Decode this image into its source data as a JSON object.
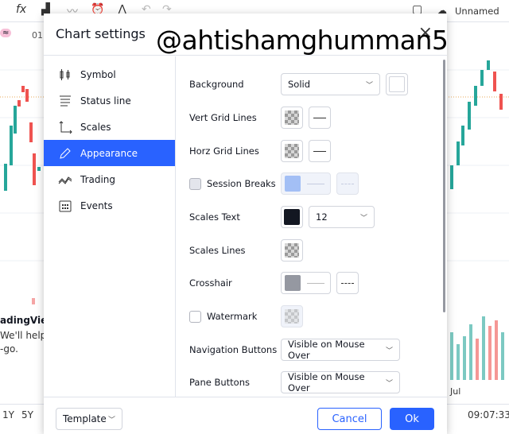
{
  "topbar": {
    "fx_icon": "fx",
    "profile_label": "Unnamed"
  },
  "background": {
    "symbol_partial": "01",
    "promo_title": "adingView",
    "promo_line1": "We'll help y",
    "promo_line2": "-go.",
    "axis_label": "Jul",
    "ranges": [
      "1Y",
      "5Y"
    ],
    "clock": "09:07:33"
  },
  "dialog": {
    "title": "Chart settings",
    "watermark_text": "@ahtishamghumman5",
    "close_icon": "×",
    "nav": [
      {
        "label": "Symbol",
        "icon": "candles-icon"
      },
      {
        "label": "Status line",
        "icon": "status-line-icon"
      },
      {
        "label": "Scales",
        "icon": "scales-icon"
      },
      {
        "label": "Appearance",
        "icon": "pencil-icon",
        "active": true
      },
      {
        "label": "Trading",
        "icon": "trading-icon"
      },
      {
        "label": "Events",
        "icon": "calendar-icon"
      }
    ],
    "settings": {
      "background": {
        "label": "Background",
        "value": "Solid",
        "color": "#ffffff"
      },
      "vert_grid": {
        "label": "Vert Grid Lines"
      },
      "horz_grid": {
        "label": "Horz Grid Lines"
      },
      "session_breaks": {
        "label": "Session Breaks",
        "checked": false,
        "color": "#a3bff5"
      },
      "scales_text": {
        "label": "Scales Text",
        "color": "#131722",
        "size": "12"
      },
      "scales_lines": {
        "label": "Scales Lines"
      },
      "crosshair": {
        "label": "Crosshair",
        "color": "#9598a1"
      },
      "watermark": {
        "label": "Watermark",
        "checked": false
      },
      "navigation_buttons": {
        "label": "Navigation Buttons",
        "value": "Visible on Mouse Over"
      },
      "pane_buttons": {
        "label": "Pane Buttons",
        "value": "Visible on Mouse Over"
      }
    },
    "footer": {
      "template": "Template",
      "cancel": "Cancel",
      "ok": "Ok"
    }
  },
  "colors": {
    "accent": "#2962ff",
    "up": "#26a69a",
    "down": "#ef5350"
  }
}
